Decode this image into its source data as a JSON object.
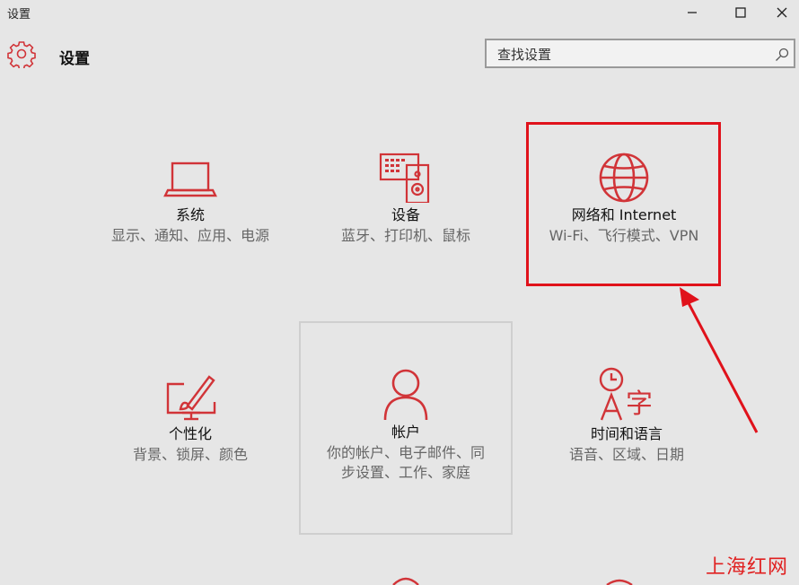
{
  "window": {
    "title": "设置",
    "controls": [
      "minimize",
      "maximize",
      "close"
    ]
  },
  "header": {
    "title": "设置",
    "icon": "gear-icon"
  },
  "search": {
    "placeholder": "查找设置",
    "icon": "search-icon"
  },
  "tiles": [
    {
      "name": "系统",
      "desc": "显示、通知、应用、电源",
      "icon": "laptop-icon"
    },
    {
      "name": "设备",
      "desc": "蓝牙、打印机、鼠标",
      "icon": "devices-icon"
    },
    {
      "name": "网络和 Internet",
      "desc": "Wi-Fi、飞行模式、VPN",
      "icon": "globe-icon"
    },
    {
      "name": "个性化",
      "desc": "背景、锁屏、颜色",
      "icon": "personalization-icon"
    },
    {
      "name": "帐户",
      "desc": "你的帐户、电子邮件、同步设置、工作、家庭",
      "icon": "person-icon"
    },
    {
      "name": "时间和语言",
      "desc": "语音、区域、日期",
      "icon": "time-language-icon"
    }
  ],
  "annotation": {
    "highlight_color": "#e0121b",
    "arrow": "pointing-to-network-tile"
  },
  "watermark": "上海红网",
  "colors": {
    "accent": "#d13438",
    "background": "#e6e6e6"
  }
}
